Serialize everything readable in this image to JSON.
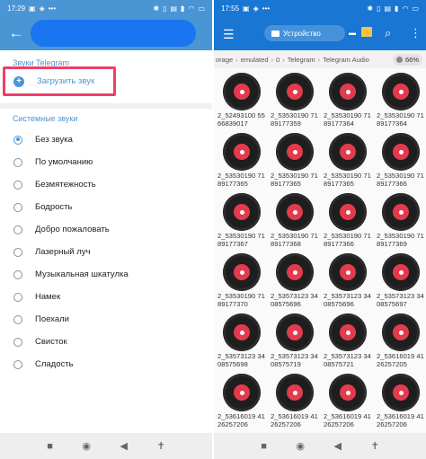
{
  "left": {
    "status": {
      "time": "17:29"
    },
    "section_telegram": "Звуки Telegram",
    "upload_label": "Загрузить звук",
    "section_system": "Системные звуки",
    "options": [
      {
        "label": "Без звука",
        "selected": true
      },
      {
        "label": "По умолчанию",
        "selected": false
      },
      {
        "label": "Безмятежность",
        "selected": false
      },
      {
        "label": "Бодрость",
        "selected": false
      },
      {
        "label": "Добро пожаловать",
        "selected": false
      },
      {
        "label": "Лазерный луч",
        "selected": false
      },
      {
        "label": "Музыкальная шкатулка",
        "selected": false
      },
      {
        "label": "Намек",
        "selected": false
      },
      {
        "label": "Поехали",
        "selected": false
      },
      {
        "label": "Свисток",
        "selected": false
      },
      {
        "label": "Сладость",
        "selected": false
      }
    ],
    "accent": "#4a95d4",
    "highlight": "#ef3e6a"
  },
  "right": {
    "status": {
      "time": "17:55"
    },
    "device_tab": "Устройство",
    "breadcrumbs": [
      "orage",
      "emulated",
      "0",
      "Telegram",
      "Telegram Audio"
    ],
    "storage_percent": "66%",
    "files": [
      "2_52493100 5566839017",
      "2_53530190 7189177359",
      "2_53530190 7189177364",
      "2_53530190 7189177364",
      "2_53530190 7189177365",
      "2_53530190 7189177365",
      "2_53530190 7189177365",
      "2_53530190 7189177366",
      "2_53530190 7189177367",
      "2_53530190 7189177368",
      "2_53530190 7189177366",
      "2_53530190 7189177369",
      "2_53530190 7189177370",
      "2_53573123 3408575696",
      "2_53573123 3408575696",
      "2_53573123 3408575697",
      "2_53573123 3408575698",
      "2_53573123 3408575719",
      "2_53573123 3408575721",
      "2_53616019 4126257205",
      "2_53616019 4126257206",
      "2_53616019 4126257206",
      "2_53616019 4126257206",
      "2_53616019 4126257206"
    ],
    "accent": "#1976d2",
    "disc_label_color": "#e33b4d"
  }
}
